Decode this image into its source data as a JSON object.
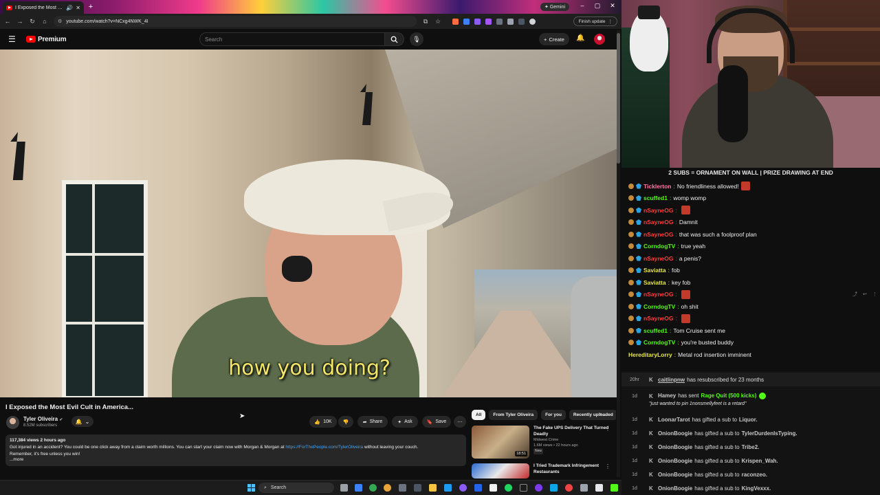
{
  "browser": {
    "tab_title": "I Exposed the Most Evil Cult",
    "gemini_label": "Gemini",
    "url": "youtube.com/watch?v=NCxg4NWK_4I",
    "finish_update_label": "Finish update"
  },
  "youtube": {
    "logo_text": "Premium",
    "search_placeholder": "Search",
    "create_label": "Create",
    "caption": "how you doing?",
    "video_title": "I Exposed the Most Evil Cult in America...",
    "channel_name": "Tyler Oliveira",
    "subscribers": "8.52M subscribers",
    "actions": {
      "likes": "10K",
      "share": "Share",
      "ask": "Ask",
      "save": "Save"
    },
    "description": {
      "meta": "117,384 views  2 hours ago",
      "text": "Got injured in an accident? You could be one click away from a claim worth millions. You can start your claim now with Morgan & Morgan at",
      "link": "https://ForThePeople.com/TylerOliveira",
      "text_after": "without leaving your couch.",
      "line2": "Remember, it's free unless you win!",
      "more": "...more"
    },
    "chips": [
      "All",
      "From Tyler Oliveira",
      "For you",
      "Recently uploaded"
    ],
    "recommendations": [
      {
        "title": "The Fake UPS Delivery That Turned Deadly",
        "channel": "Midwest Crime",
        "meta": "1.6M views • 22 hours ago",
        "badge": "New",
        "duration": "18:51"
      },
      {
        "title": "I Tried Trademark Infringement Restaurants",
        "channel": "",
        "meta": "",
        "badge": "",
        "duration": ""
      }
    ]
  },
  "taskbar": {
    "search_label": "Search"
  },
  "stream": {
    "banner": "2 SUBS = ORNAMENT ON WALL | PRIZE DRAWING AT END",
    "chat": [
      {
        "user": "Ticklerton",
        "color": "#ff7aa8",
        "text": "No friendliness allowed!",
        "emote": true
      },
      {
        "user": "scuffed1",
        "color": "#53fc18",
        "text": "womp womp",
        "emote": false
      },
      {
        "user": "nSayneOG",
        "color": "#ff3b3b",
        "text": "",
        "emote": true
      },
      {
        "user": "nSayneOG",
        "color": "#ff3b3b",
        "text": "Damnit",
        "emote": false
      },
      {
        "user": "nSayneOG",
        "color": "#ff3b3b",
        "text": "that was such a foolproof plan",
        "emote": false
      },
      {
        "user": "CorndogTV",
        "color": "#53fc18",
        "text": "true yeah",
        "emote": false
      },
      {
        "user": "nSayneOG",
        "color": "#ff3b3b",
        "text": "a penis?",
        "emote": false
      },
      {
        "user": "Saviatta",
        "color": "#e8e84a",
        "text": "fob",
        "emote": false
      },
      {
        "user": "Saviatta",
        "color": "#e8e84a",
        "text": "key fob",
        "emote": false
      },
      {
        "user": "nSayneOG",
        "color": "#ff3b3b",
        "text": "",
        "emote": true
      },
      {
        "user": "CorndogTV",
        "color": "#53fc18",
        "text": "oh shit",
        "emote": false
      },
      {
        "user": "nSayneOG",
        "color": "#ff3b3b",
        "text": "",
        "emote": true
      },
      {
        "user": "scuffed1",
        "color": "#53fc18",
        "text": "Tom Cruise sent me",
        "emote": false
      },
      {
        "user": "CorndogTV",
        "color": "#53fc18",
        "text": "you're busted buddy",
        "emote": false
      },
      {
        "user": "HereditaryLorry",
        "color": "#e8e84a",
        "text": "Metal rod insertion imminent",
        "emote": false
      }
    ],
    "events": [
      {
        "time": "20hr",
        "user": "caitlinpnw",
        "action": "has resubscribed for 23 months",
        "target": ""
      },
      {
        "time": "1d",
        "user": "Hamey",
        "action": "has sent",
        "target": "Rage Quit (500 kicks)"
      },
      {
        "time": "1d",
        "user": "LoonarTarot",
        "action": "has gifted a sub to",
        "target": "Liquor."
      },
      {
        "time": "1d",
        "user": "OnionBoogie",
        "action": "has gifted a sub to",
        "target": "TylerDurdenIsTyping."
      },
      {
        "time": "1d",
        "user": "OnionBoogie",
        "action": "has gifted a sub to",
        "target": "Tribe2."
      },
      {
        "time": "1d",
        "user": "OnionBoogie",
        "action": "has gifted a sub to",
        "target": "Krispen_Wah."
      },
      {
        "time": "1d",
        "user": "OnionBoogie",
        "action": "has gifted a sub to",
        "target": "raconzeo."
      },
      {
        "time": "1d",
        "user": "OnionBoogie",
        "action": "has gifted a sub to",
        "target": "KingVexxx."
      }
    ],
    "event_quote": "\"just wanted to pin 1nonsmellyfeet is a retard\"",
    "event_k": "K"
  }
}
